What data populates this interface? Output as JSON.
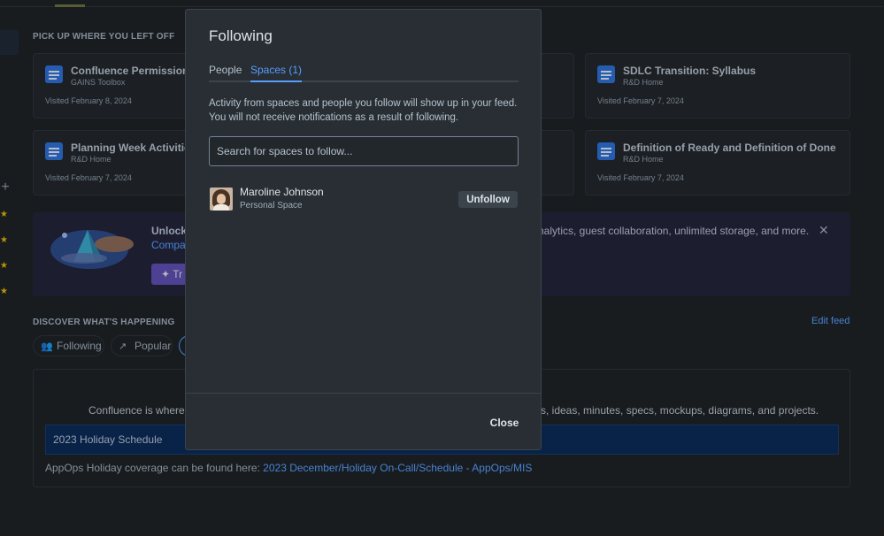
{
  "recent": {
    "heading": "PICK UP WHERE YOU LEFT OFF",
    "cards": [
      {
        "title": "Confluence Permissions",
        "space": "GAINS Toolbox",
        "visited": "Visited February 8, 2024"
      },
      {
        "title": "SDLC Transition: Syllabus",
        "space": "R&D Home",
        "visited": "Visited February 7, 2024"
      },
      {
        "title": "Planning Week Activities",
        "space": "R&D Home",
        "visited": "Visited February 7, 2024"
      },
      {
        "title": "Definition of Ready and Definition of Done",
        "space": "R&D Home",
        "visited": "Visited February 7, 2024"
      }
    ]
  },
  "banner": {
    "title": "Unlock",
    "link": "Compa",
    "try_label": "Tr",
    "tail": "nalytics, guest collaboration, unlimited storage, and more.",
    "close_glyph": "✕",
    "accent": "#5e4db2"
  },
  "discover": {
    "heading": "DISCOVER WHAT'S HAPPENING",
    "edit_feed": "Edit feed",
    "filters": [
      {
        "label": "Following",
        "icon": "people-icon"
      },
      {
        "label": "Popular",
        "icon": "trend-icon"
      }
    ]
  },
  "feed": {
    "intro": "Confluence is where y",
    "intro_tail": "s, ideas, minutes, specs, mockups, diagrams, and projects.",
    "highlight": "2023 Holiday Schedule",
    "coverage_text": "AppOps Holiday coverage can be found here: ",
    "coverage_link": "2023 December/Holiday On-Call/Schedule - AppOps/MIS"
  },
  "modal": {
    "title": "Following",
    "tabs": [
      {
        "label": "People",
        "active": false
      },
      {
        "label": "Spaces (1)",
        "active": true
      }
    ],
    "description": "Activity from spaces and people you follow will show up in your feed. You will not receive notifications as a result of following.",
    "search_placeholder": "Search for spaces to follow...",
    "followed": [
      {
        "name": "Maroline Johnson",
        "type": "Personal Space",
        "action": "Unfollow"
      }
    ],
    "close_label": "Close"
  },
  "icons": {
    "plus": "+",
    "star": "★",
    "sparkle": "✦",
    "people": "👥",
    "trend": "↗"
  },
  "colors": {
    "background": "#1d2125",
    "modal": "#282e33",
    "link": "#579dff",
    "star": "#e2b203"
  }
}
